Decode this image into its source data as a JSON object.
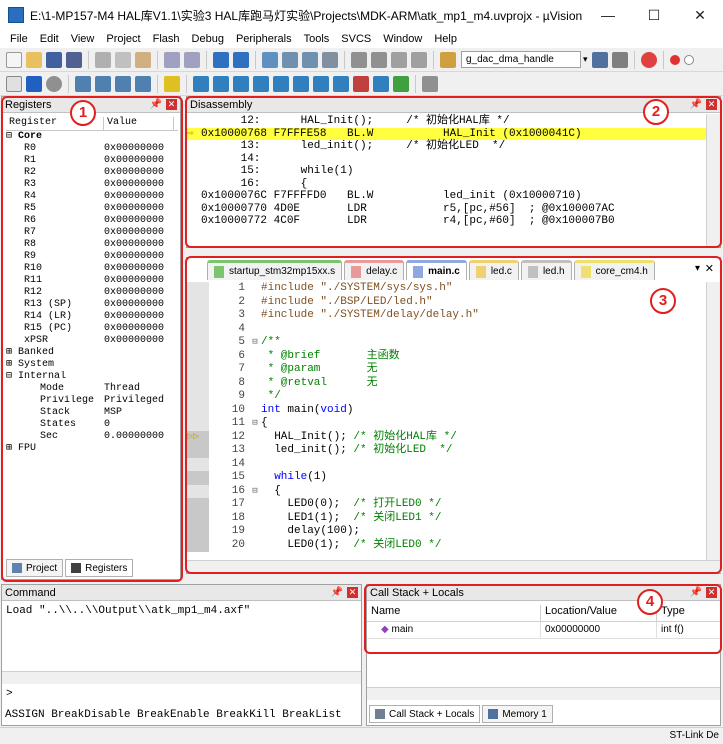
{
  "window": {
    "title": "E:\\1-MP157-M4 HAL库V1.1\\实验3 HAL库跑马灯实验\\Projects\\MDK-ARM\\atk_mp1_m4.uvprojx - µVision",
    "min": "—",
    "max": "☐",
    "close": "✕"
  },
  "menu": [
    "File",
    "Edit",
    "View",
    "Project",
    "Flash",
    "Debug",
    "Peripherals",
    "Tools",
    "SVCS",
    "Window",
    "Help"
  ],
  "toolbar": {
    "target_text": "g_dac_dma_handle"
  },
  "registers": {
    "title": "Registers",
    "col_register": "Register",
    "col_value": "Value",
    "core_label": "Core",
    "core": [
      {
        "name": "R0",
        "value": "0x00000000"
      },
      {
        "name": "R1",
        "value": "0x00000000"
      },
      {
        "name": "R2",
        "value": "0x00000000"
      },
      {
        "name": "R3",
        "value": "0x00000000"
      },
      {
        "name": "R4",
        "value": "0x00000000"
      },
      {
        "name": "R5",
        "value": "0x00000000"
      },
      {
        "name": "R6",
        "value": "0x00000000"
      },
      {
        "name": "R7",
        "value": "0x00000000"
      },
      {
        "name": "R8",
        "value": "0x00000000"
      },
      {
        "name": "R9",
        "value": "0x00000000"
      },
      {
        "name": "R10",
        "value": "0x00000000"
      },
      {
        "name": "R11",
        "value": "0x00000000"
      },
      {
        "name": "R12",
        "value": "0x00000000"
      },
      {
        "name": "R13 (SP)",
        "value": "0x00000000"
      },
      {
        "name": "R14 (LR)",
        "value": "0x00000000"
      },
      {
        "name": "R15 (PC)",
        "value": "0x00000000"
      },
      {
        "name": "xPSR",
        "value": "0x00000000"
      }
    ],
    "banked": "Banked",
    "system": "System",
    "internal": "Internal",
    "internal_rows": [
      {
        "name": "Mode",
        "value": "Thread"
      },
      {
        "name": "Privilege",
        "value": "Privileged"
      },
      {
        "name": "Stack",
        "value": "MSP"
      },
      {
        "name": "States",
        "value": "0"
      },
      {
        "name": "Sec",
        "value": "0.00000000"
      }
    ],
    "fpu": "FPU",
    "tab_project": "Project",
    "tab_registers": "Registers"
  },
  "disassembly": {
    "title": "Disassembly",
    "lines": [
      {
        "addr": "      12:",
        "op": "",
        "text": "      HAL_Init();     /* 初始化HAL库 */",
        "hl": false
      },
      {
        "addr": "0x10000768 F7FFFE58",
        "op": "BL.W",
        "text": "HAL_Init (0x1000041C)",
        "hl": true
      },
      {
        "addr": "      13:",
        "op": "",
        "text": "      led_init();     /* 初始化LED  */",
        "hl": false
      },
      {
        "addr": "      14:",
        "op": "",
        "text": "",
        "hl": false
      },
      {
        "addr": "      15:",
        "op": "",
        "text": "      while(1)",
        "hl": false
      },
      {
        "addr": "      16:",
        "op": "",
        "text": "      {",
        "hl": false
      },
      {
        "addr": "0x1000076C F7FFFFD0",
        "op": "BL.W",
        "text": "led_init (0x10000710)",
        "hl": false
      },
      {
        "addr": "0x10000770 4D0E",
        "op": "LDR",
        "text": "r5,[pc,#56]  ; @0x100007AC",
        "hl": false
      },
      {
        "addr": "0x10000772 4C0F",
        "op": "LDR",
        "text": "r4,[pc,#60]  ; @0x100007B0",
        "hl": false
      }
    ]
  },
  "editor": {
    "tabs": [
      {
        "label": "startup_stm32mp15xx.s",
        "color": "#7cc56e"
      },
      {
        "label": "delay.c",
        "color": "#e89a9a"
      },
      {
        "label": "main.c",
        "color": "#8fa8e0"
      },
      {
        "label": "led.c",
        "color": "#f0d070"
      },
      {
        "label": "led.h",
        "color": "#c0c0c0"
      },
      {
        "label": "core_cm4.h",
        "color": "#f0e070"
      }
    ],
    "lines": [
      {
        "n": "1",
        "t": "#include \"./SYSTEM/sys/sys.h\""
      },
      {
        "n": "2",
        "t": "#include \"./BSP/LED/led.h\""
      },
      {
        "n": "3",
        "t": "#include \"./SYSTEM/delay/delay.h\""
      },
      {
        "n": "4",
        "t": ""
      },
      {
        "n": "5",
        "t": "/**"
      },
      {
        "n": "6",
        "t": " * @brief       主函数"
      },
      {
        "n": "7",
        "t": " * @param       无"
      },
      {
        "n": "8",
        "t": " * @retval      无"
      },
      {
        "n": "9",
        "t": " */"
      },
      {
        "n": "10",
        "t": "int main(void)"
      },
      {
        "n": "11",
        "t": "{"
      },
      {
        "n": "12",
        "t": "  HAL_Init(); /* 初始化HAL库 */"
      },
      {
        "n": "13",
        "t": "  led_init(); /* 初始化LED  */"
      },
      {
        "n": "14",
        "t": ""
      },
      {
        "n": "15",
        "t": "  while(1)"
      },
      {
        "n": "16",
        "t": "  {"
      },
      {
        "n": "17",
        "t": "    LED0(0);  /* 打开LED0 */"
      },
      {
        "n": "18",
        "t": "    LED1(1);  /* 关闭LED1 */"
      },
      {
        "n": "19",
        "t": "    delay(100);"
      },
      {
        "n": "20",
        "t": "    LED0(1);  /* 关闭LED0 */"
      }
    ]
  },
  "command": {
    "title": "Command",
    "output": "Load \"..\\\\..\\\\Output\\\\atk_mp1_m4.axf\"",
    "prompt": ">",
    "hint": "ASSIGN BreakDisable BreakEnable BreakKill BreakList"
  },
  "callstack": {
    "title": "Call Stack + Locals",
    "col_name": "Name",
    "col_loc": "Location/Value",
    "col_type": "Type",
    "row": {
      "name": "main",
      "loc": "0x00000000",
      "type": "int f()"
    },
    "tab_callstack": "Call Stack + Locals",
    "tab_memory": "Memory 1"
  },
  "status": {
    "text": "ST-Link De"
  },
  "markers": [
    "1",
    "2",
    "3",
    "4"
  ]
}
